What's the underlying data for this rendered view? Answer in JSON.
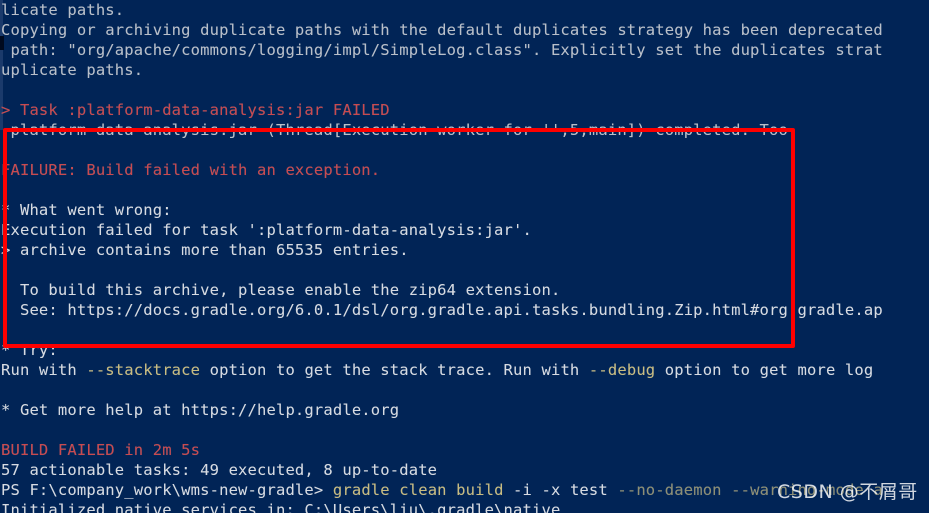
{
  "terminal": {
    "shell": "powershell",
    "background_color": "#012456",
    "foreground_color": "#c8cdd6",
    "error_color": "#c94a4f",
    "option_color": "#c9bc80",
    "annotation_color": "#fe0000"
  },
  "annotation": {
    "type": "red-rectangle",
    "label": "highlight-box"
  },
  "watermark": {
    "text": "CSDN @不屑哥"
  },
  "lines": [
    {
      "id": "l01",
      "text": "licate paths.",
      "color": "grey"
    },
    {
      "id": "l02",
      "text": "Copying or archiving duplicate paths with the default duplicates strategy has been deprecated",
      "color": "grey"
    },
    {
      "id": "l03",
      "text": " path: \"org/apache/commons/logging/impl/SimpleLog.class\". Explicitly set the duplicates strat",
      "color": "grey"
    },
    {
      "id": "l04",
      "text": "uplicate paths.",
      "color": "grey"
    },
    {
      "id": "l05",
      "text": "",
      "color": "grey"
    },
    {
      "id": "l06",
      "text": "> Task :platform-data-analysis:jar FAILED",
      "color": "red"
    },
    {
      "id": "l07",
      "text": ".platform-data-analysis.jar (Thread[Execution worker for '',5,main]) completed. Too",
      "color": "grey"
    },
    {
      "id": "l08",
      "text": "",
      "color": "grey"
    },
    {
      "id": "l09",
      "text": "FAILURE: Build failed with an exception.",
      "color": "red"
    },
    {
      "id": "l10",
      "text": "",
      "color": "grey"
    },
    {
      "id": "l11",
      "text": "* What went wrong:",
      "color": "white"
    },
    {
      "id": "l12",
      "text": "Execution failed for task ':platform-data-analysis:jar'.",
      "color": "white"
    },
    {
      "id": "l13",
      "text": "> archive contains more than 65535 entries.",
      "color": "white"
    },
    {
      "id": "l14",
      "text": "",
      "color": "grey"
    },
    {
      "id": "l15",
      "text": "  To build this archive, please enable the zip64 extension.",
      "color": "white"
    },
    {
      "id": "l16",
      "text": "  See: https://docs.gradle.org/6.0.1/dsl/org.gradle.api.tasks.bundling.Zip.html#org.gradle.ap",
      "color": "white"
    },
    {
      "id": "l17",
      "text": "",
      "color": "grey"
    },
    {
      "id": "l18",
      "text": "* Try:",
      "color": "white"
    },
    {
      "id": "l19",
      "segments": [
        {
          "text": "Run with ",
          "color": "white"
        },
        {
          "text": "--stacktrace",
          "color": "yellow"
        },
        {
          "text": " option to get the stack trace. Run with ",
          "color": "white"
        },
        {
          "text": "--debug",
          "color": "yellow"
        },
        {
          "text": " option to get more log",
          "color": "white"
        }
      ]
    },
    {
      "id": "l20",
      "text": "",
      "color": "grey"
    },
    {
      "id": "l21",
      "text": "* Get more help at https://help.gradle.org",
      "color": "white"
    },
    {
      "id": "l22",
      "text": "",
      "color": "grey"
    },
    {
      "id": "l23",
      "text": "BUILD FAILED in 2m 5s",
      "color": "red"
    },
    {
      "id": "l24",
      "text": "57 actionable tasks: 49 executed, 8 up-to-date",
      "color": "white"
    },
    {
      "id": "l25",
      "segments": [
        {
          "text": "PS F:\\company_work\\wms-new-gradle> ",
          "color": "white"
        },
        {
          "text": "gradle clean build ",
          "color": "yellow"
        },
        {
          "text": "-i -x ",
          "color": "white"
        },
        {
          "text": "test ",
          "color": "white"
        },
        {
          "text": "--no-daemon ",
          "color": "dimyel"
        },
        {
          "text": "--warning-mode a",
          "color": "dimyel"
        }
      ]
    },
    {
      "id": "l26",
      "text": "Initialized native services in: C:\\Users\\liu\\.gradle\\native",
      "color": "white"
    }
  ],
  "build": {
    "status_label": "BUILD FAILED",
    "duration": "2m 5s",
    "tasks_total": "57",
    "tasks_executed": "49",
    "tasks_up_to_date": "8",
    "failed_task": ":platform-data-analysis:jar",
    "error_reason": "archive contains more than 65535 entries.",
    "suggested_fix": "enable the zip64 extension",
    "gradle_version": "6.0.1",
    "help_url": "https://help.gradle.org",
    "docs_url": "https://docs.gradle.org/6.0.1/dsl/org.gradle.api.tasks.bundling.Zip.html",
    "working_directory": "F:\\company_work\\wms-new-gradle",
    "command": "gradle clean build -i -x test --no-daemon --warning-mode a",
    "native_services_dir": "C:\\Users\\liu\\.gradle\\native"
  }
}
